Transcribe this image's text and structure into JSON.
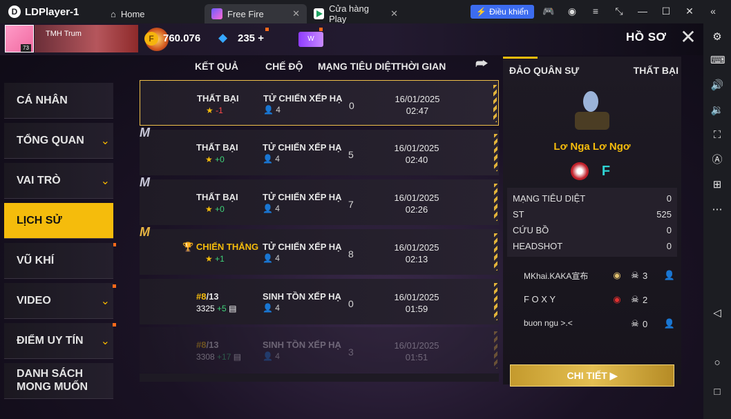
{
  "titlebar": {
    "app_name": "LDPlayer-1",
    "tabs": [
      {
        "label": "Home"
      },
      {
        "label": "Free Fire"
      },
      {
        "label": "Cửa hàng Play"
      }
    ],
    "control_label": "Điều khiển"
  },
  "header": {
    "player_tag": "TMH",
    "player_name": "Trum",
    "level": "73",
    "gold": "760.076",
    "diamonds": "235",
    "diamond_plus": "+",
    "wheel_label": "W",
    "title": "HỒ SƠ"
  },
  "menu": {
    "items": [
      {
        "label": "CÁ NHÂN"
      },
      {
        "label": "TỔNG QUAN"
      },
      {
        "label": "VAI TRÒ"
      },
      {
        "label": "LỊCH SỬ"
      },
      {
        "label": "VŨ KHÍ"
      },
      {
        "label": "VIDEO"
      },
      {
        "label": "ĐIỂM UY TÍN"
      },
      {
        "label_line1": "DANH SÁCH",
        "label_line2": "MONG MUỐN"
      }
    ]
  },
  "table": {
    "headers": {
      "result": "KẾT QUẢ",
      "mode": "CHẾ ĐỘ",
      "kills": "MẠNG TIÊU DIỆT",
      "time": "THỜI GIAN"
    },
    "rows": [
      {
        "result": "THẤT BẠI",
        "star": "★",
        "delta": "-1",
        "mode": "TỬ CHIẾN XẾP HẠ",
        "players": "4",
        "kills": "0",
        "date": "16/01/2025",
        "time": "02:47"
      },
      {
        "result": "THẤT BẠI",
        "star": "★",
        "delta": "+0",
        "mode": "TỬ CHIẾN XẾP HẠ",
        "players": "4",
        "kills": "5",
        "date": "16/01/2025",
        "time": "02:40"
      },
      {
        "result": "THẤT BẠI",
        "star": "★",
        "delta": "+0",
        "mode": "TỬ CHIẾN XẾP HẠ",
        "players": "4",
        "kills": "7",
        "date": "16/01/2025",
        "time": "02:26"
      },
      {
        "result": "CHIẾN THẮNG",
        "star": "★",
        "delta": "+1",
        "mode": "TỬ CHIẾN XẾP HẠ",
        "players": "4",
        "kills": "8",
        "date": "16/01/2025",
        "time": "02:13"
      },
      {
        "rank": "#8",
        "total": "/13",
        "points": "3325",
        "delta": "+5",
        "mode": "SINH TỒN XẾP HẠ",
        "players": "4",
        "kills": "0",
        "date": "16/01/2025",
        "time": "01:59"
      },
      {
        "rank": "#8",
        "total": "/13",
        "points": "3308",
        "delta": "+17",
        "mode": "SINH TỒN XẾP HẠ",
        "players": "4",
        "kills": "3",
        "date": "16/01/2025",
        "time": "01:51"
      }
    ]
  },
  "detail": {
    "map": "ĐẢO QUÂN SỰ",
    "result": "THẤT BẠI",
    "player_name": "Lơ Nga Lơ Ngơ",
    "stats": [
      {
        "label": "MẠNG TIÊU DIỆT",
        "value": "0"
      },
      {
        "label": "ST",
        "value": "525"
      },
      {
        "label": "CỨU BỒ",
        "value": "0"
      },
      {
        "label": "HEADSHOT",
        "value": "0"
      }
    ],
    "team": [
      {
        "name": "MKhai.KAKA宣布",
        "kills": "3"
      },
      {
        "name": "F O X Y",
        "kills": "2"
      },
      {
        "name": "buon ngu >.<",
        "kills": "0"
      }
    ],
    "button_label": "CHI TIẾT"
  }
}
